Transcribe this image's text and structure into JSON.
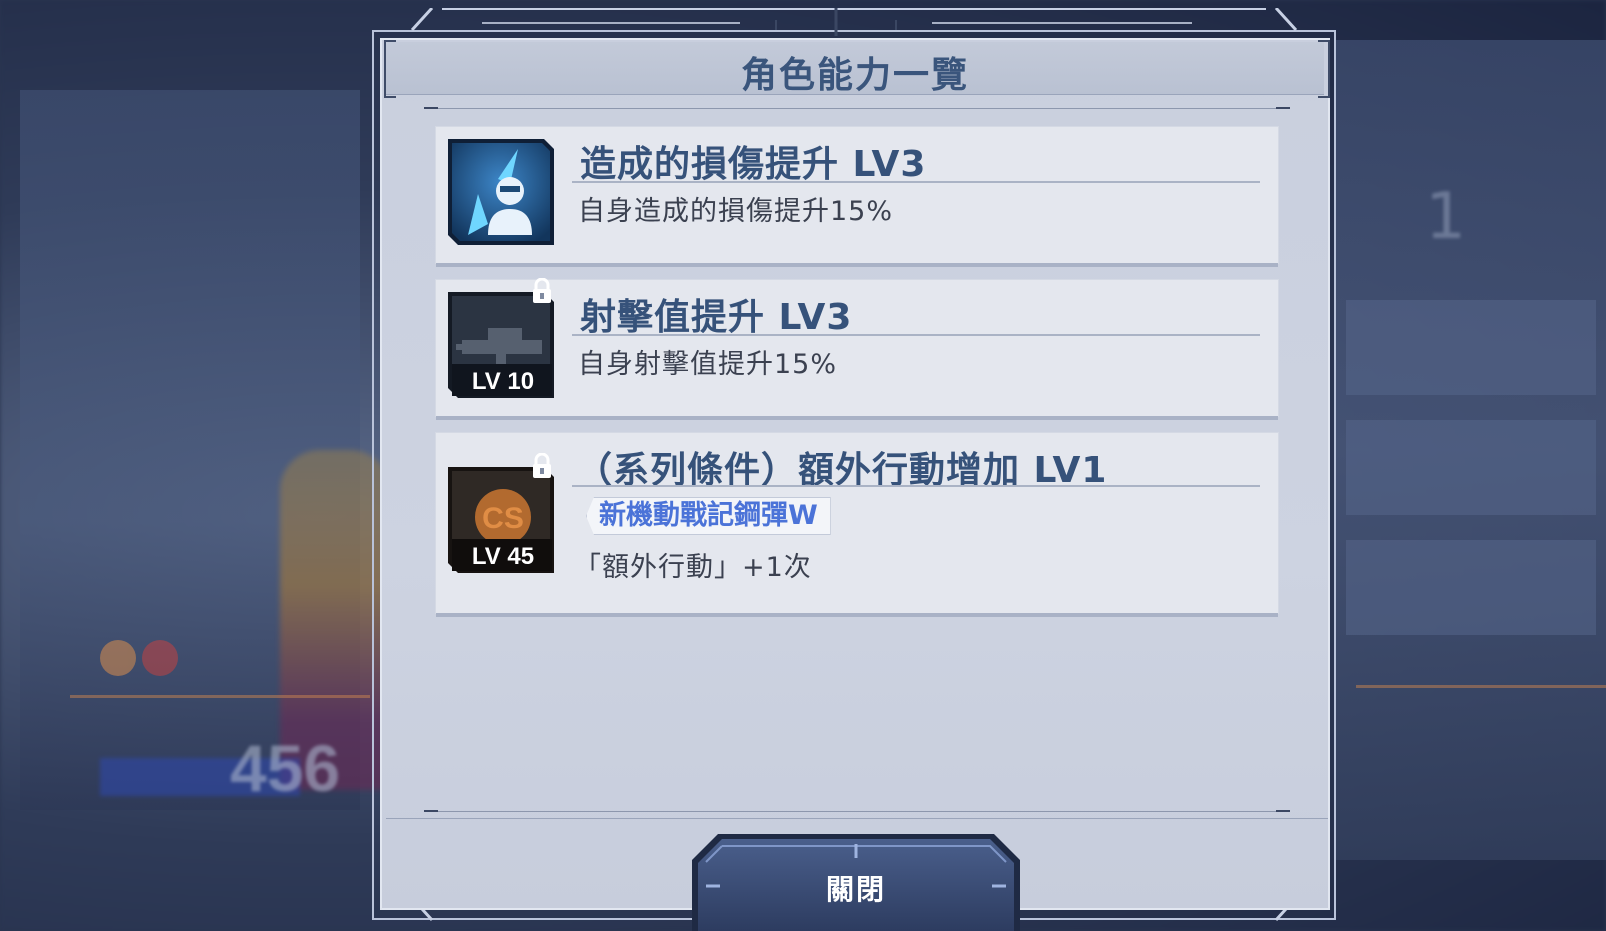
{
  "dialog": {
    "title": "角色能力一覽",
    "close_label": "關閉"
  },
  "abilities": [
    {
      "title": "造成的損傷提升 LV3",
      "description": "自身造成的損傷提升15%",
      "icon": "pilot-attack-icon",
      "locked": false
    },
    {
      "title": "射擊值提升 LV3",
      "description": "自身射擊值提升15%",
      "icon": "beam-rifle-icon",
      "level_badge": "LV 10",
      "locked": true
    },
    {
      "title": "（系列條件）額外行動增加 LV1",
      "condition_tag": "新機動戰記鋼彈W",
      "description": "「額外行動」+1次",
      "icon": "cs-icon",
      "icon_text": "CS",
      "level_badge": "LV 45",
      "locked": true
    }
  ],
  "background": {
    "number": "456",
    "side_number": "1"
  },
  "colors": {
    "title_text": "#3a557c",
    "tag_text": "#4b73d8",
    "card_bg": "#e4e7ee",
    "dialog_bg": "#cbd1df"
  }
}
